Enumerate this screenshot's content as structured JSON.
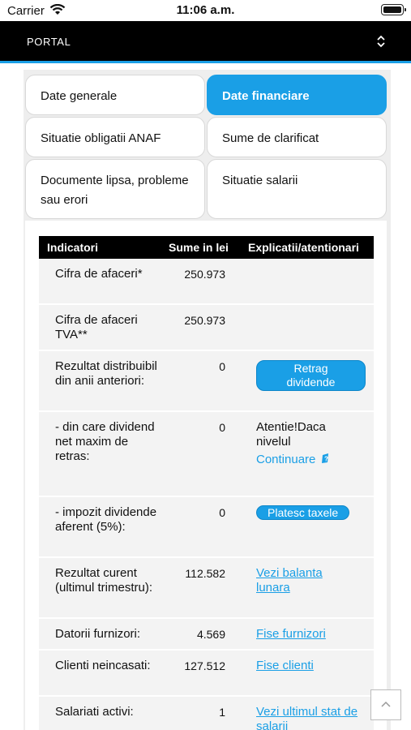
{
  "status_bar": {
    "carrier": "Carrier",
    "time": "11:06 a.m."
  },
  "header": {
    "title": "PORTAL"
  },
  "tabs": [
    {
      "label": "Date generale"
    },
    {
      "label": "Date financiare"
    },
    {
      "label": "Situatie obligatii ANAF"
    },
    {
      "label": "Sume de clarificat"
    },
    {
      "label": "Documente lipsa, probleme sau erori"
    },
    {
      "label": "Situatie salarii"
    }
  ],
  "table": {
    "headers": [
      "Indicatori",
      "Sume in lei",
      "Explicatii/atentionari"
    ],
    "rows": [
      {
        "label": "Cifra de afaceri*",
        "value": "250.973"
      },
      {
        "label": "Cifra de afaceri TVA**",
        "value": "250.973"
      },
      {
        "label": "Rezultat distribuibil din anii anteriori:",
        "value": "0",
        "action": "Retrag dividende"
      },
      {
        "label": "- din care dividend net maxim de retras:",
        "value": "0",
        "note": "Atentie!Daca nivelul",
        "link": "Continuare"
      },
      {
        "label": "- impozit dividende aferent (5%):",
        "value": "0",
        "action": "Platesc taxele"
      },
      {
        "label": "Rezultat curent (ultimul trimestru):",
        "value": "112.582",
        "link": "Vezi balanta lunara"
      },
      {
        "label": "Datorii furnizori:",
        "value": "4.569",
        "link": "Fise furnizori"
      },
      {
        "label": "Clienti neincasati:",
        "value": "127.512",
        "link": "Fise clienti"
      },
      {
        "label": "Salariati activi:",
        "value": "1",
        "link": "Vezi ultimul stat de salarii"
      }
    ]
  },
  "colors": {
    "accent": "#1a9fe6",
    "header_bg": "#000000"
  }
}
